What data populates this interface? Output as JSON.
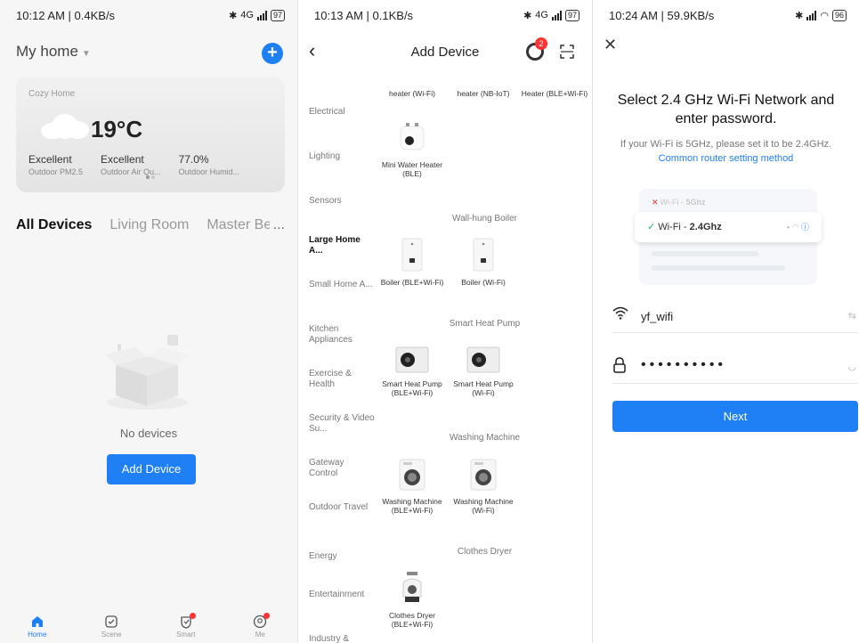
{
  "home": {
    "status": {
      "time": "10:12 AM | 0.4KB/s",
      "battery": "97",
      "net": "4G"
    },
    "title": "My home",
    "card": {
      "label": "Cozy Home",
      "temp": "19°C",
      "stats": [
        {
          "value": "Excellent",
          "label": "Outdoor PM2.5"
        },
        {
          "value": "Excellent",
          "label": "Outdoor Air Qu..."
        },
        {
          "value": "77.0%",
          "label": "Outdoor Humid..."
        }
      ]
    },
    "tabs": [
      "All Devices",
      "Living Room",
      "Master Bec"
    ],
    "tabs_more": "...",
    "empty_text": "No devices",
    "add_button": "Add Device",
    "nav": [
      "Home",
      "Scene",
      "Smart",
      "Me"
    ]
  },
  "add_device": {
    "status": {
      "time": "10:13 AM | 0.1KB/s",
      "battery": "97",
      "net": "4G"
    },
    "title": "Add Device",
    "badge_count": "2",
    "categories": [
      "Electrical",
      "Lighting",
      "Sensors",
      "Large Home A...",
      "Small Home A...",
      "Kitchen Appliances",
      "Exercise & Health",
      "Security & Video Su...",
      "Gateway Control",
      "Outdoor Travel",
      "Energy",
      "Entertainment",
      "Industry &"
    ],
    "top_devices": [
      "heater (Wi-Fi)",
      "heater (NB-IoT)",
      "Heater (BLE+Wi-Fi)"
    ],
    "mini_heater": "Mini Water Heater (BLE)",
    "sections": [
      {
        "title": "Wall-hung Boiler",
        "devices": [
          "Boiler (BLE+Wi-Fi)",
          "Boiler (Wi-Fi)"
        ]
      },
      {
        "title": "Smart Heat Pump",
        "devices": [
          "Smart Heat Pump (BLE+Wi-Fi)",
          "Smart Heat Pump (Wi-Fi)"
        ]
      },
      {
        "title": "Washing Machine",
        "devices": [
          "Washing Machine (BLE+Wi-Fi)",
          "Washing Machine (Wi-Fi)"
        ]
      },
      {
        "title": "Clothes Dryer",
        "devices": [
          "Clothes Dryer (BLE+Wi-Fi)"
        ]
      }
    ]
  },
  "wifi": {
    "status": {
      "time": "10:24 AM | 59.9KB/s",
      "battery": "96"
    },
    "title": "Select 2.4 GHz Wi-Fi Network and enter password.",
    "hint": "If your Wi-Fi is 5GHz, please set it to be 2.4GHz.",
    "link": "Common router setting method",
    "illus": {
      "bad_prefix": "Wi-Fi - ",
      "bad_band": "5Ghz",
      "good_prefix": "Wi-Fi - ",
      "good_band": "2.4Ghz"
    },
    "ssid": "yf_wifi",
    "password_mask": "••••••••••",
    "next_button": "Next"
  }
}
